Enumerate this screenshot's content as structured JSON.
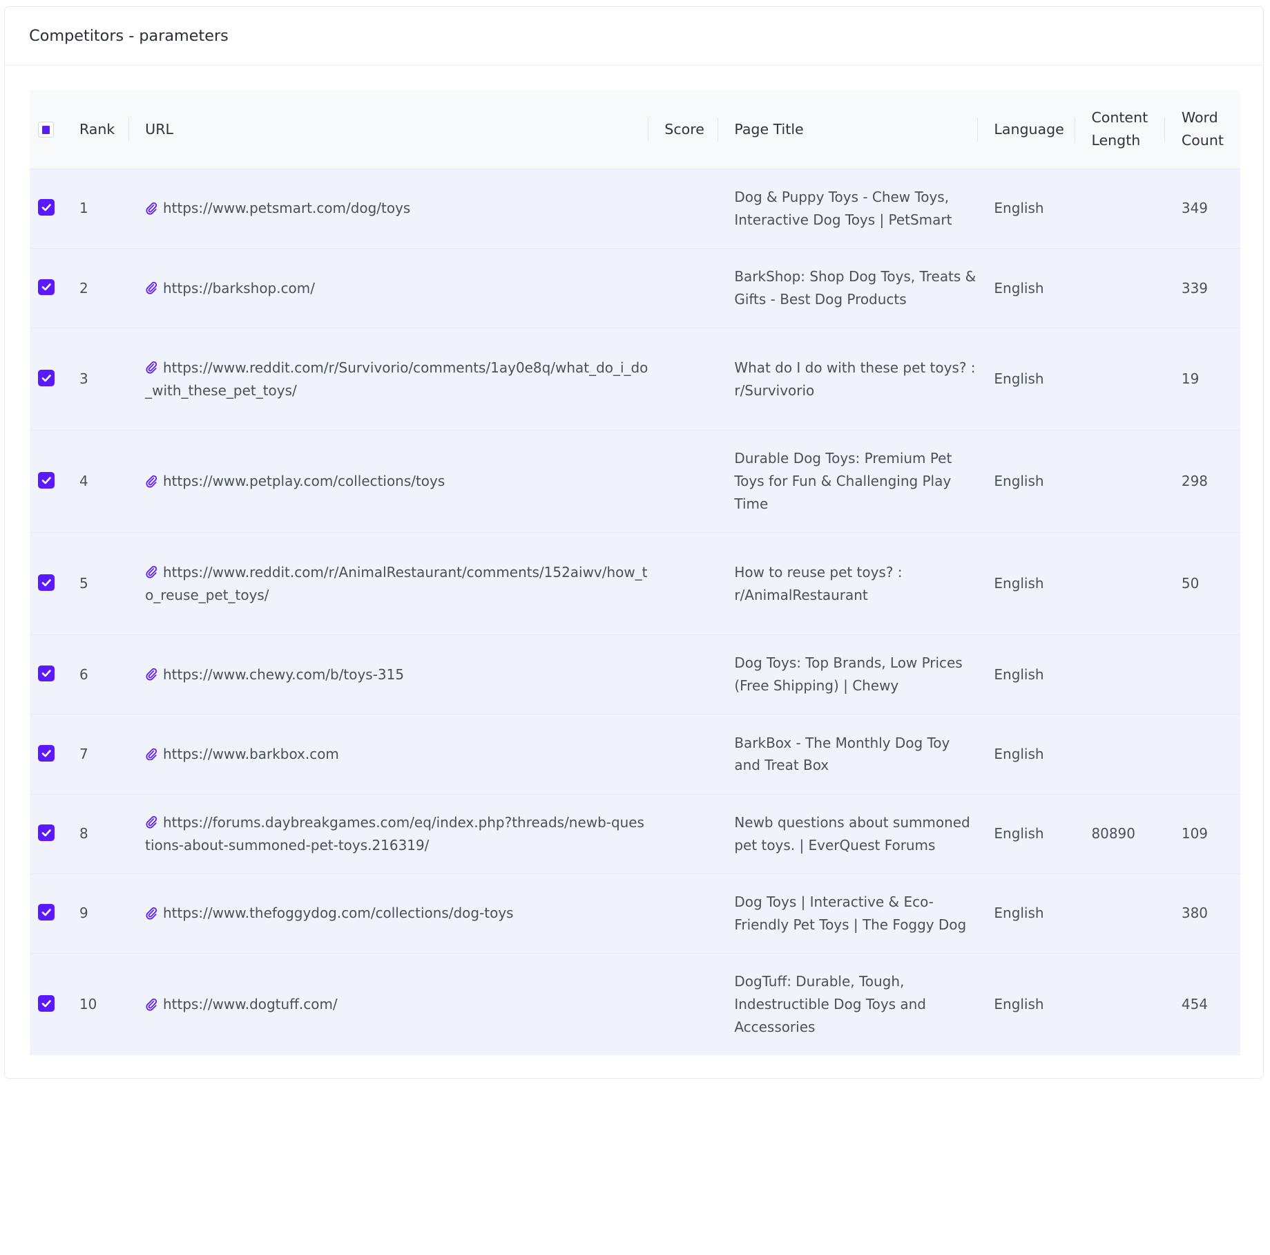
{
  "card": {
    "title": "Competitors - parameters"
  },
  "table": {
    "columns": {
      "rank": "Rank",
      "url": "URL",
      "score": "Score",
      "page_title": "Page Title",
      "language": "Language",
      "content_length": "Content Length",
      "word_count": "Word Count"
    },
    "header_checkbox_state": "indeterminate",
    "rows": [
      {
        "rank": "1",
        "url": "https://www.petsmart.com/dog/toys",
        "score": "",
        "title": "Dog & Puppy Toys - Chew Toys, Interactive Dog Toys | PetSmart",
        "language": "English",
        "content_length": "",
        "word_count": "349"
      },
      {
        "rank": "2",
        "url": "https://barkshop.com/",
        "score": "",
        "title": "BarkShop: Shop Dog Toys, Treats & Gifts - Best Dog Products",
        "language": "English",
        "content_length": "",
        "word_count": "339"
      },
      {
        "rank": "3",
        "url": "https://www.reddit.com/r/Survivorio/comments/1ay0e8q/what_do_i_do_with_these_pet_toys/",
        "score": "",
        "title": "What do I do with these pet toys? : r/Survivorio",
        "language": "English",
        "content_length": "",
        "word_count": "19"
      },
      {
        "rank": "4",
        "url": "https://www.petplay.com/collections/toys",
        "score": "",
        "title": "Durable Dog Toys: Premium Pet Toys for Fun & Challenging Play Time",
        "language": "English",
        "content_length": "",
        "word_count": "298"
      },
      {
        "rank": "5",
        "url": "https://www.reddit.com/r/AnimalRestaurant/comments/152aiwv/how_to_reuse_pet_toys/",
        "score": "",
        "title": "How to reuse pet toys? : r/AnimalRestaurant",
        "language": "English",
        "content_length": "",
        "word_count": "50"
      },
      {
        "rank": "6",
        "url": "https://www.chewy.com/b/toys-315",
        "score": "",
        "title": "Dog Toys: Top Brands, Low Prices (Free Shipping) | Chewy",
        "language": "English",
        "content_length": "",
        "word_count": ""
      },
      {
        "rank": "7",
        "url": "https://www.barkbox.com",
        "score": "",
        "title": "BarkBox - The Monthly Dog Toy and Treat Box",
        "language": "English",
        "content_length": "",
        "word_count": ""
      },
      {
        "rank": "8",
        "url": "https://forums.daybreakgames.com/eq/index.php?threads/newb-questions-about-summoned-pet-toys.216319/",
        "score": "",
        "title": "Newb questions about summoned pet toys. | EverQuest Forums",
        "language": "English",
        "content_length": "80890",
        "word_count": "109"
      },
      {
        "rank": "9",
        "url": "https://www.thefoggydog.com/collections/dog-toys",
        "score": "",
        "title": "Dog Toys | Interactive & Eco-Friendly Pet Toys | The Foggy Dog",
        "language": "English",
        "content_length": "",
        "word_count": "380"
      },
      {
        "rank": "10",
        "url": "https://www.dogtuff.com/",
        "score": "",
        "title": "DogTuff: Durable, Tough, Indestructible Dog Toys and Accessories",
        "language": "English",
        "content_length": "",
        "word_count": "454"
      }
    ]
  },
  "icons": {
    "row_checkbox": "checkmark-icon",
    "url_prefix": "paperclip-icon"
  },
  "colors": {
    "accent": "#5b19ff",
    "row_bg": "#f0f2fc",
    "header_bg": "#f8f9fa"
  }
}
